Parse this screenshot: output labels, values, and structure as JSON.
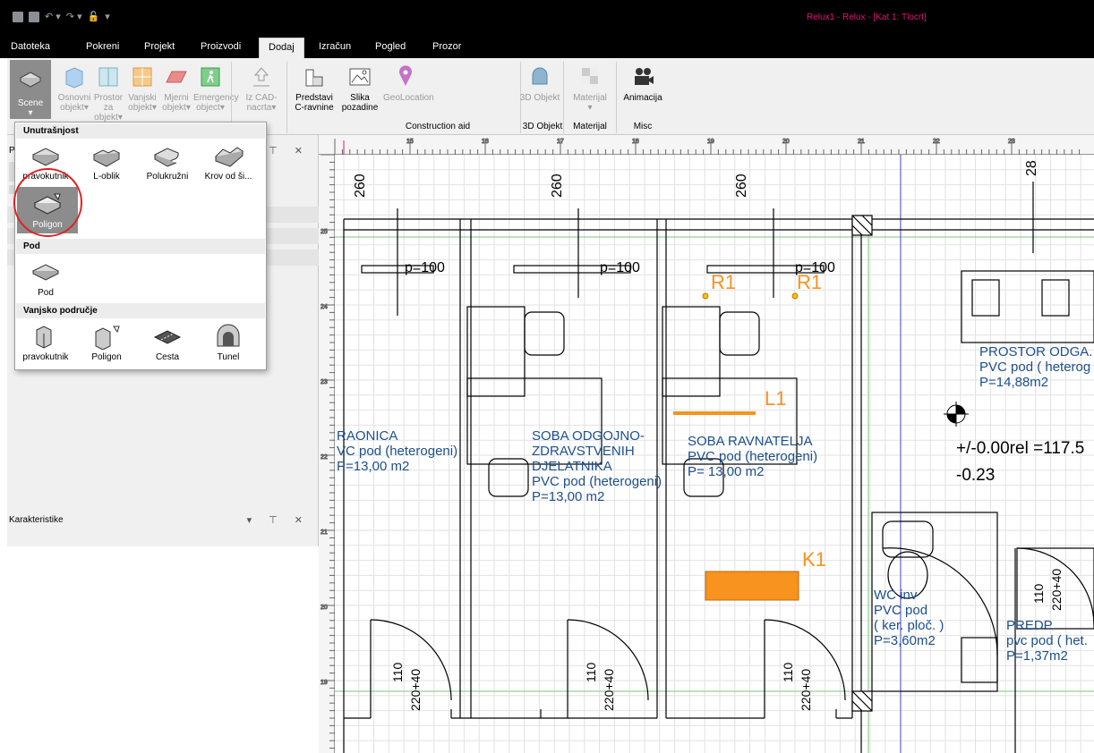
{
  "window": {
    "title": "Relux1 - Relux - [Kat 1: Tlocrt]"
  },
  "menu": {
    "tabs": [
      "Datoteka",
      "Pokreni",
      "Projekt",
      "Proizvodi",
      "Dodaj",
      "Izračun",
      "Pogled",
      "Prozor"
    ],
    "active": "Dodaj"
  },
  "ribbon": {
    "scene": "Scene",
    "buttons": [
      {
        "label": "Osnovni objekt",
        "arrow": "▾"
      },
      {
        "label": "Prostor za objekt",
        "arrow": "▾"
      },
      {
        "label": "Vanjski objekt",
        "arrow": "▾"
      },
      {
        "label": "Mjerni objekt",
        "arrow": "▾"
      },
      {
        "label": "Emergency object",
        "arrow": "▾"
      },
      {
        "label": "Iz CAD-nacrta",
        "arrow": "▾"
      },
      {
        "label": "Predstavi C-ravnine"
      },
      {
        "label": "Slika pozadine"
      },
      {
        "label": "GeoLocation"
      },
      {
        "label": "3D Objekt"
      },
      {
        "label": "Materijal"
      },
      {
        "label": "Animacija"
      }
    ],
    "groups": [
      "Construction aid",
      "3D Objekt",
      "Materijal",
      "Misc"
    ]
  },
  "leftpanel": {
    "header_letter": "P",
    "properties_title": "Karakteristike"
  },
  "dropdown": {
    "sections": [
      {
        "title": "Unutrašnjost",
        "items": [
          "pravokutnik",
          "L-oblik",
          "Polukružni",
          "Krov od ši...",
          "Poligon"
        ]
      },
      {
        "title": "Pod",
        "items": [
          "Pod"
        ]
      },
      {
        "title": "Vanjsko područje",
        "items": [
          "pravokutnik",
          "Poligon",
          "Cesta",
          "Tunel"
        ]
      }
    ],
    "selected": "Poligon"
  },
  "drawing": {
    "ruler_top": [
      "15",
      "16",
      "17",
      "18",
      "19",
      "20",
      "21",
      "22",
      "23"
    ],
    "ruler_left": [
      "25",
      "24",
      "23",
      "22",
      "21",
      "20",
      "19"
    ],
    "dims_260": [
      "260",
      "260",
      "260"
    ],
    "dim_28": "28",
    "p_labels": [
      "p=100",
      "p=100",
      "p=100"
    ],
    "rooms": [
      {
        "lines": [
          "RAONICA",
          "VC pod (heterogeni)",
          "P=13,00 m2"
        ]
      },
      {
        "lines": [
          "SOBA ODGOJNO-",
          "ZDRAVSTVENIH",
          "DJELATNIKA",
          "PVC pod (heterogeni)",
          "P=13,00 m2"
        ]
      },
      {
        "lines": [
          "SOBA RAVNATELJA",
          "PVC pod (heterogeni)",
          "P= 13,00 m2"
        ]
      },
      {
        "lines": [
          "PROSTOR ODGA.",
          "PVC pod ( heterog",
          "P=14,88m2"
        ]
      },
      {
        "lines": [
          "WC inv",
          "PVC pod",
          "( ker. ploč. )",
          "P=3,60m2"
        ]
      },
      {
        "lines": [
          "PREDP.",
          "pvc pod ( het.",
          "P=1,37m2"
        ]
      }
    ],
    "orange_labels": [
      "R1",
      "R1",
      "L1",
      "K1"
    ],
    "elevation": "+/-0.00rel =117.5",
    "elevation2": "-0.23",
    "door_dims": [
      "110",
      "220+40",
      "110",
      "220+40",
      "110",
      "220+40",
      "110",
      "220+40"
    ],
    "colors": {
      "room_text": "#1d4f8c",
      "luminaire": "#f7931e",
      "accent": "#e0147a"
    }
  }
}
